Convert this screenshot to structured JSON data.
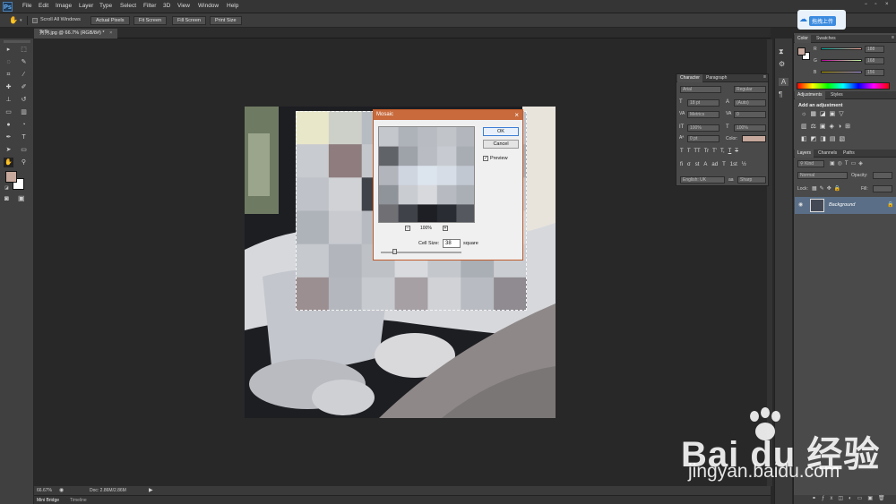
{
  "menubar": {
    "logo": "Ps",
    "items": [
      "File",
      "Edit",
      "Image",
      "Layer",
      "Type",
      "Select",
      "Filter",
      "3D",
      "View",
      "Window",
      "Help"
    ]
  },
  "options_bar": {
    "scroll_all_windows": "Scroll All Windows",
    "buttons": [
      "Actual Pixels",
      "Fit Screen",
      "Fill Screen",
      "Print Size"
    ]
  },
  "upload_badge": {
    "label": "拖拽上传"
  },
  "document_tab": {
    "label": "狗狗.jpg @ 66.7% (RGB/8#) *",
    "close": "×"
  },
  "status": {
    "zoom": "66.67%",
    "doc_info": "Doc: 2.86M/2.86M"
  },
  "bottom_tabs": [
    "Mini Bridge",
    "Timeline"
  ],
  "colors": {
    "foreground": "#c7a89c",
    "background": "#ffffff",
    "accent": "#c86a3c",
    "panel": "#4a4a4a"
  },
  "color_panel": {
    "tabs": [
      "Color",
      "Swatches"
    ],
    "channels": [
      {
        "label": "R",
        "value": "188"
      },
      {
        "label": "G",
        "value": "168"
      },
      {
        "label": "B",
        "value": "156"
      }
    ]
  },
  "adjustments_panel": {
    "tabs": [
      "Adjustments",
      "Styles"
    ],
    "heading": "Add an adjustment"
  },
  "layers_panel": {
    "tabs": [
      "Layers",
      "Channels",
      "Paths"
    ],
    "kind": "Kind",
    "blend_mode": "Normal",
    "opacity_label": "Opacity:",
    "lock_label": "Lock:",
    "fill_label": "Fill:",
    "layer_name": "Background"
  },
  "character_panel": {
    "tabs": [
      "Character",
      "Paragraph"
    ],
    "font_family": "Arial",
    "font_style": "Regular",
    "font_size": "18 pt",
    "leading": "(Auto)",
    "kerning": "Metrics",
    "tracking": "0",
    "vscale": "100%",
    "hscale": "100%",
    "baseline": "0 pt",
    "color_label": "Color:",
    "language": "English: UK",
    "aa_label": "aa",
    "antialias": "Sharp",
    "style_buttons": [
      "T",
      "T",
      "TT",
      "Tr",
      "T'",
      "T,",
      "T",
      "T"
    ],
    "feature_buttons": [
      "fi",
      "σ",
      "st",
      "A",
      "ad",
      "T",
      "1st",
      "½"
    ]
  },
  "mosaic_dialog": {
    "title": "Mosaic",
    "ok": "OK",
    "cancel": "Cancel",
    "preview_label": "Preview",
    "preview_checked": true,
    "zoom": "100%",
    "zoom_out": "−",
    "zoom_in": "+",
    "cell_size_label": "Cell Size:",
    "cell_size_value": "38",
    "unit": "square"
  },
  "watermark": {
    "text": "Bai du 经验",
    "url": "jingyan.baidu.com"
  }
}
